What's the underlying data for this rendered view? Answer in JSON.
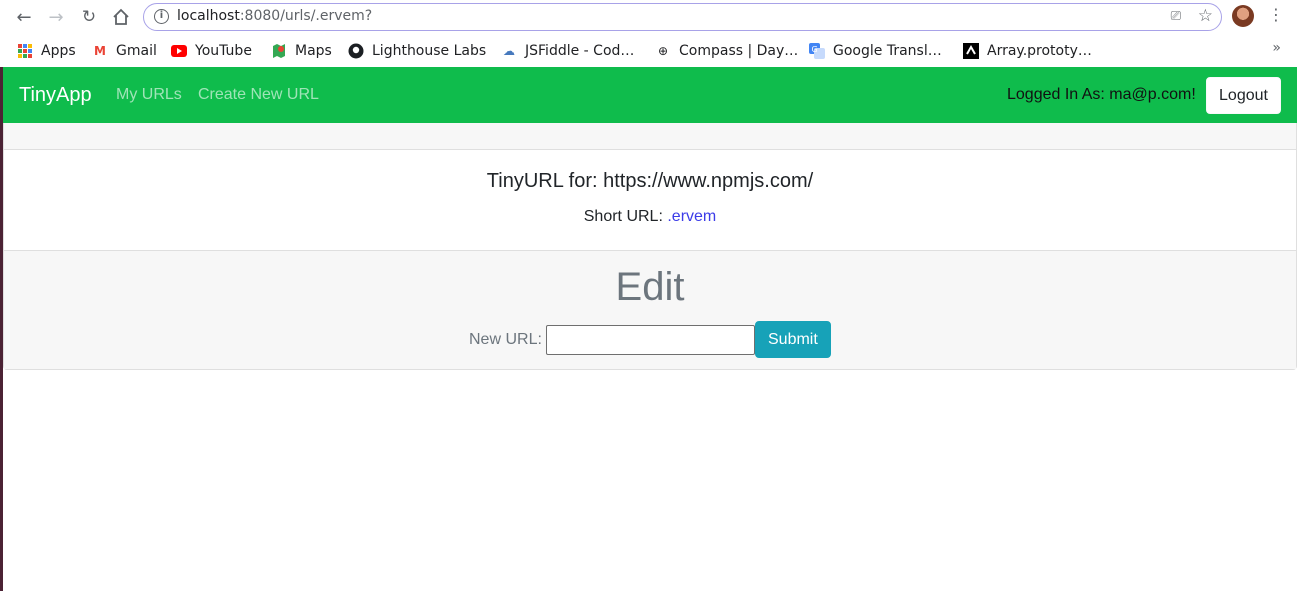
{
  "browser": {
    "address": {
      "host": "localhost",
      "path": ":8080/urls/.ervem?"
    },
    "bookmarks": [
      {
        "label": "Apps",
        "icon": "apps-grid-icon"
      },
      {
        "label": "Gmail",
        "icon": "gmail-icon"
      },
      {
        "label": "YouTube",
        "icon": "youtube-icon"
      },
      {
        "label": "Maps",
        "icon": "maps-icon"
      },
      {
        "label": "Lighthouse Labs",
        "icon": "github-icon"
      },
      {
        "label": "JSFiddle - Cod…",
        "icon": "jsfiddle-icon"
      },
      {
        "label": "Compass | Day…",
        "icon": "compass-icon"
      },
      {
        "label": "Google Transl…",
        "icon": "translate-icon"
      },
      {
        "label": "Array.prototy…",
        "icon": "mdn-icon"
      }
    ],
    "more_label": "»"
  },
  "navbar": {
    "brand": "TinyApp",
    "links": [
      "My URLs",
      "Create New URL"
    ],
    "logged_in": "Logged In As: ma@p.com!",
    "logout": "Logout",
    "color": "#0fbc4c"
  },
  "main": {
    "title": "TinyURL for: https://www.npmjs.com/",
    "short_label": "Short URL:",
    "short_value": ".ervem",
    "edit_title": "Edit",
    "new_url_label": "New URL:",
    "submit": "Submit"
  }
}
